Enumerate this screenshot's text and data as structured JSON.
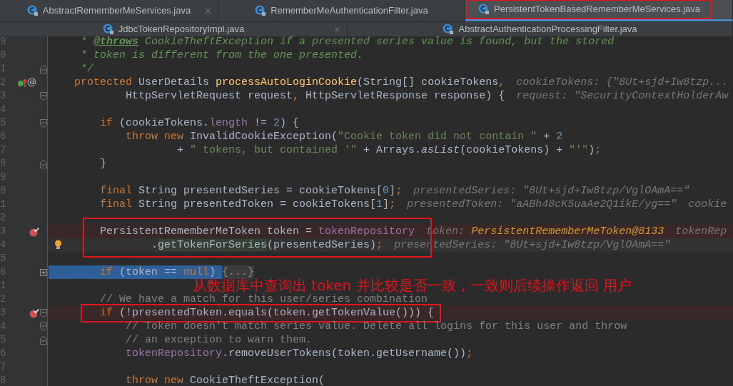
{
  "tabs": [
    [
      {
        "label": "AbstractRememberMeServices.java",
        "selected": false,
        "closable": true
      },
      {
        "label": "RememberMeAuthenticationFilter.java",
        "selected": false,
        "closable": false
      },
      {
        "label": "PersistentTokenBasedRememberMeServices.java",
        "selected": true,
        "closable": false,
        "framed": true
      }
    ],
    [
      {
        "label": "JdbcTokenRepositoryImpl.java",
        "selected": false,
        "closable": true
      },
      {
        "label": "AbstractAuthenticationProcessingFilter.java",
        "selected": false,
        "closable": false
      }
    ]
  ],
  "lines": [
    {
      "number": "9",
      "selected": false,
      "code": [
        {
          "kind": "doc",
          "text": "     * "
        },
        {
          "kind": "doctag",
          "text": "@throws"
        },
        {
          "kind": "doc",
          "text": " CookieTheftException if a presented series value is found, but the stored"
        }
      ]
    },
    {
      "number": "0",
      "selected": false,
      "code": [
        {
          "kind": "doc",
          "text": "     * token is different from the one presented."
        }
      ]
    },
    {
      "number": "1",
      "selected": false,
      "fold_end": true,
      "code": [
        {
          "kind": "doc",
          "text": "     */"
        }
      ]
    },
    {
      "number": "2",
      "selected": false,
      "override": true,
      "code": [
        {
          "kind": "keyword",
          "text": "    protected "
        },
        {
          "kind": "plain",
          "text": "UserDetails "
        },
        {
          "kind": "method",
          "text": "processAutoLoginCookie"
        },
        {
          "kind": "plain",
          "text": "(String[] cookieTokens"
        },
        {
          "kind": "keyword",
          "text": ","
        }
      ],
      "hints": [
        {
          "kind": "text",
          "name": "cookieTokens:",
          "value": "{\"8Ut+sjd+Iw8tzp..."
        }
      ]
    },
    {
      "number": "3",
      "selected": false,
      "fold_start": true,
      "code": [
        {
          "kind": "plain",
          "text": "            HttpServletRequest request"
        },
        {
          "kind": "keyword",
          "text": ", "
        },
        {
          "kind": "plain",
          "text": "HttpServletResponse response) {"
        }
      ],
      "hints": [
        {
          "kind": "text",
          "name": "request:",
          "value": "\"SecurityContextHolderAw"
        }
      ]
    },
    {
      "number": "4",
      "selected": false
    },
    {
      "number": "5",
      "selected": false,
      "fold_start": true,
      "code": [
        {
          "kind": "keyword",
          "text": "        if "
        },
        {
          "kind": "plain",
          "text": "(cookieTokens."
        },
        {
          "kind": "field",
          "text": "length "
        },
        {
          "kind": "plain",
          "text": "!= "
        },
        {
          "kind": "number",
          "text": "2"
        },
        {
          "kind": "plain",
          "text": ") {"
        }
      ]
    },
    {
      "number": "6",
      "selected": false,
      "code": [
        {
          "kind": "keyword",
          "text": "            throw new "
        },
        {
          "kind": "plain",
          "text": "InvalidCookieException("
        },
        {
          "kind": "string",
          "text": "\"Cookie token did not contain \" "
        },
        {
          "kind": "plain",
          "text": "+ "
        },
        {
          "kind": "number",
          "text": "2"
        }
      ]
    },
    {
      "number": "7",
      "selected": false,
      "code": [
        {
          "kind": "plain",
          "text": "                    + "
        },
        {
          "kind": "string",
          "text": "\" tokens, but contained '\" "
        },
        {
          "kind": "plain",
          "text": "+ Arrays."
        },
        {
          "kind": "static",
          "text": "asList"
        },
        {
          "kind": "plain",
          "text": "(cookieTokens) + "
        },
        {
          "kind": "string",
          "text": "\"'\""
        },
        {
          "kind": "plain",
          "text": ")"
        },
        {
          "kind": "keyword",
          "text": ";"
        }
      ]
    },
    {
      "number": "8",
      "selected": false,
      "fold_end": true,
      "code": [
        {
          "kind": "plain",
          "text": "        }"
        }
      ]
    },
    {
      "number": "9",
      "selected": false
    },
    {
      "number": "0",
      "selected": false,
      "code": [
        {
          "kind": "keyword",
          "text": "        final "
        },
        {
          "kind": "plain",
          "text": "String presentedSeries = cookieTokens["
        },
        {
          "kind": "number",
          "text": "0"
        },
        {
          "kind": "plain",
          "text": "]"
        },
        {
          "kind": "keyword",
          "text": ";"
        }
      ],
      "hints": [
        {
          "kind": "text",
          "name": "presentedSeries:",
          "value": "\"8Ut+sjd+Iw8tzp/VglOAmA==\""
        }
      ]
    },
    {
      "number": "1",
      "selected": false,
      "code": [
        {
          "kind": "keyword",
          "text": "        final "
        },
        {
          "kind": "plain",
          "text": "String presentedToken = cookieTokens["
        },
        {
          "kind": "number",
          "text": "1"
        },
        {
          "kind": "plain",
          "text": "]"
        },
        {
          "kind": "keyword",
          "text": ";"
        }
      ],
      "hints": [
        {
          "kind": "text",
          "name": "presentedToken:",
          "value": "\"aABh48cK5uaAe2Q1ikE/yg==\""
        },
        {
          "kind": "text",
          "name": "cookie"
        }
      ]
    },
    {
      "number": "2",
      "selected": false
    },
    {
      "number": "3",
      "selected": false,
      "breakpoint": true,
      "code": [
        {
          "kind": "plain",
          "text": "        PersistentRememberMeToken token = "
        },
        {
          "kind": "field",
          "text": "tokenRepository"
        }
      ],
      "hints": [
        {
          "kind": "object",
          "name": "token:",
          "value": "PersistentRememberMeToken@8133"
        },
        {
          "kind": "text",
          "name": "tokenRep"
        }
      ]
    },
    {
      "number": "4",
      "selected": false,
      "current": true,
      "bulb": true,
      "code": [
        {
          "kind": "plain",
          "text": "                ."
        },
        {
          "kind": "marked",
          "text": "getTokenForSeries"
        },
        {
          "kind": "plain",
          "text": "(presentedSeries)"
        },
        {
          "kind": "keyword",
          "text": ";"
        }
      ],
      "hints": [
        {
          "kind": "text",
          "name": "presentedSeries:",
          "value": "\"8Ut+sjd+Iw8tzp/VglOAmA==\""
        }
      ]
    },
    {
      "number": "5",
      "selected": false
    },
    {
      "number": "6",
      "selected": true,
      "collapsed": true,
      "code": [
        {
          "kind": "keyword",
          "text": "        if "
        },
        {
          "kind": "plain",
          "text": "(token == "
        },
        {
          "kind": "keyword",
          "text": "null"
        },
        {
          "kind": "plain",
          "text": ") "
        }
      ],
      "folded": "{...}"
    },
    {
      "number": "1",
      "selected": false
    },
    {
      "number": "2",
      "selected": false,
      "code": [
        {
          "kind": "comment",
          "text": "        // We have a match for this user/series combination"
        }
      ]
    },
    {
      "number": "3",
      "selected": false,
      "breakpoint": true,
      "fold_start": true,
      "framed": true,
      "code": [
        {
          "kind": "keyword",
          "text": "        if "
        },
        {
          "kind": "plain",
          "text": "(!presentedToken.equals(token.getTokenValue())) {"
        }
      ]
    },
    {
      "number": "4",
      "selected": false,
      "fold_start": true,
      "code": [
        {
          "kind": "comment",
          "text": "            // Token doesn't match series value. Delete all logins for this user and throw"
        }
      ]
    },
    {
      "number": "5",
      "selected": false,
      "fold_end": true,
      "code": [
        {
          "kind": "comment",
          "text": "            // an exception to warn them."
        }
      ]
    },
    {
      "number": "6",
      "selected": false,
      "code": [
        {
          "kind": "field",
          "text": "            tokenRepository"
        },
        {
          "kind": "plain",
          "text": ".removeUserTokens(token.getUsername())"
        },
        {
          "kind": "keyword",
          "text": ";"
        }
      ]
    },
    {
      "number": "7",
      "selected": false
    },
    {
      "number": "8",
      "selected": false,
      "code": [
        {
          "kind": "keyword",
          "text": "            throw new "
        },
        {
          "kind": "plain",
          "text": "CookieTheftException("
        }
      ]
    }
  ],
  "annotation": {
    "text": "从数据库中查询出 token 并比较是否一致，一致则后续操作返回 用户"
  }
}
